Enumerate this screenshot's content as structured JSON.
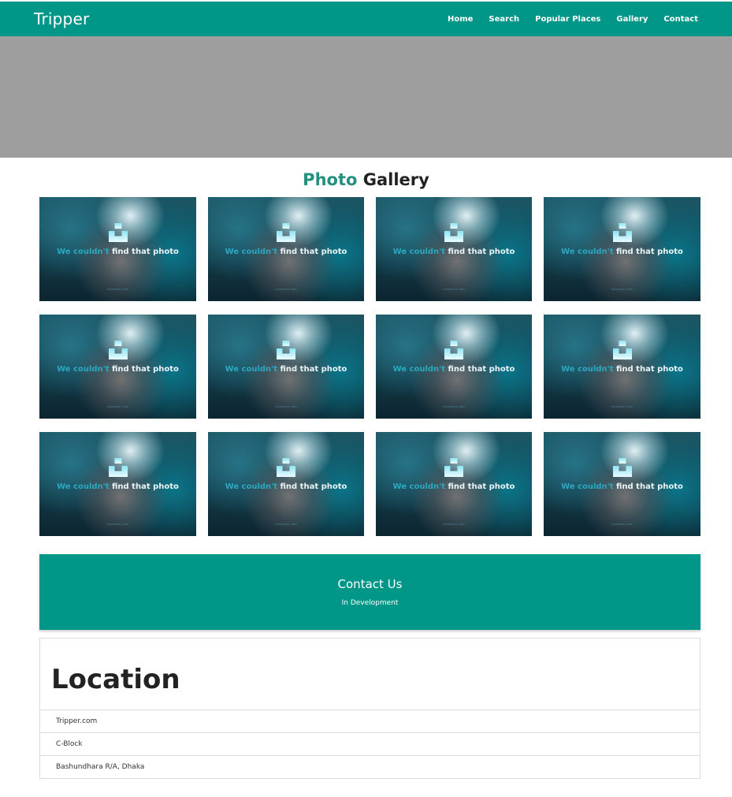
{
  "navbar": {
    "brand": "Tripper",
    "links": [
      "Home",
      "Search",
      "Popular Places",
      "Gallery",
      "Contact"
    ],
    "color": "#009688"
  },
  "hero": {
    "color": "#9e9e9e"
  },
  "gallery": {
    "title_accent": "Photo",
    "title_rest": " Gallery",
    "tile_message_1": "We couldn't",
    "tile_message_2": "find",
    "tile_message_3": "that",
    "tile_message_4": "photo",
    "tile_url": "unsplash.com",
    "tile_count": 12,
    "accent_color": "#26907f"
  },
  "contact": {
    "title": "Contact Us",
    "subtitle": "In Development"
  },
  "location": {
    "title": "Location",
    "items": [
      "Tripper.com",
      "C-Block",
      "Bashundhara R/A, Dhaka"
    ]
  }
}
